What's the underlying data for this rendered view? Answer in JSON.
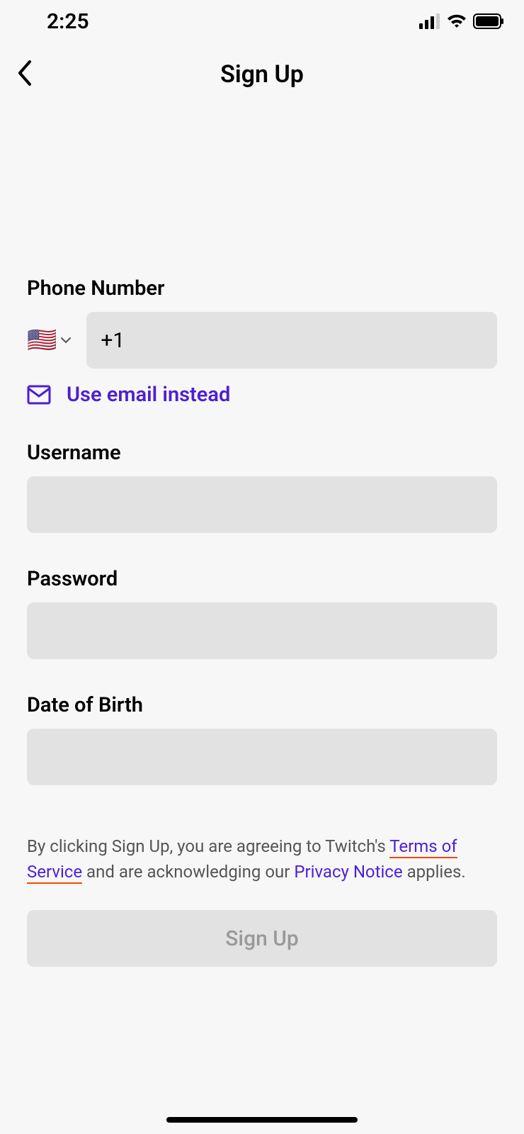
{
  "statusBar": {
    "time": "2:25"
  },
  "header": {
    "title": "Sign Up"
  },
  "form": {
    "phone": {
      "label": "Phone Number",
      "countryFlag": "🇺🇸",
      "value": "+1"
    },
    "emailLink": "Use email instead",
    "username": {
      "label": "Username",
      "value": ""
    },
    "password": {
      "label": "Password",
      "value": ""
    },
    "dob": {
      "label": "Date of Birth",
      "value": ""
    },
    "legal": {
      "prefix": "By clicking Sign Up, you are agreeing to Twitch's ",
      "tosLink": "Terms of Service",
      "middle": " and are acknowledging our ",
      "privacyLink": "Privacy Notice",
      "suffix": " applies."
    },
    "submitLabel": "Sign Up"
  }
}
